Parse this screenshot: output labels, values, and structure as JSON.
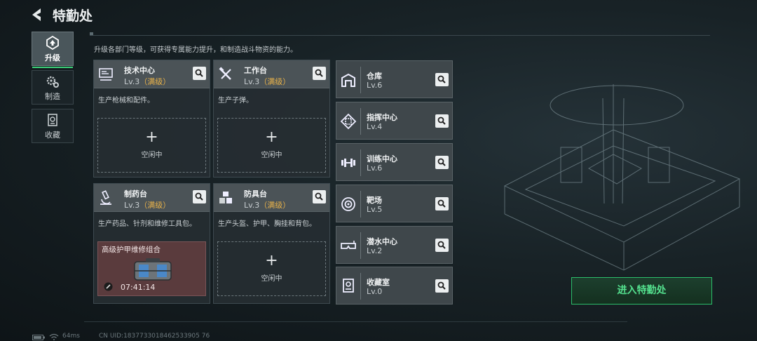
{
  "header": {
    "title": "特勤处"
  },
  "nav": {
    "items": [
      {
        "label": "升级",
        "icon": "upgrade-icon",
        "active": true
      },
      {
        "label": "制造",
        "icon": "gears-icon",
        "active": false
      },
      {
        "label": "收藏",
        "icon": "collection-icon",
        "active": false
      }
    ]
  },
  "description": "升级各部门等级，可获得专属能力提升，和制造战斗物资的能力。",
  "departments": [
    {
      "name": "技术中心",
      "level": "Lv.3",
      "max": "（满级）",
      "desc": "生产枪械和配件。",
      "slot": {
        "state": "idle",
        "plus": "+",
        "text": "空闲中"
      }
    },
    {
      "name": "工作台",
      "level": "Lv.3",
      "max": "（满级）",
      "desc": "生产子弹。",
      "slot": {
        "state": "idle",
        "plus": "+",
        "text": "空闲中"
      }
    },
    {
      "name": "制药台",
      "level": "Lv.3",
      "max": "（满级）",
      "desc": "生产药品、针剂和维修工具包。",
      "slot": {
        "state": "crafting",
        "item": "高级护甲维修组合",
        "time": "07:41:14"
      }
    },
    {
      "name": "防具台",
      "level": "Lv.3",
      "max": "（满级）",
      "desc": "生产头盔、护甲、胸挂和背包。",
      "slot": {
        "state": "idle",
        "plus": "+",
        "text": "空闲中"
      }
    }
  ],
  "facilities": [
    {
      "name": "仓库",
      "level": "Lv.6",
      "icon": "warehouse-icon"
    },
    {
      "name": "指挥中心",
      "level": "Lv.4",
      "icon": "command-center-icon"
    },
    {
      "name": "训练中心",
      "level": "Lv.6",
      "icon": "dumbbell-icon"
    },
    {
      "name": "靶场",
      "level": "Lv.5",
      "icon": "target-icon"
    },
    {
      "name": "潜水中心",
      "level": "Lv.2",
      "icon": "diving-mask-icon"
    },
    {
      "name": "收藏室",
      "level": "Lv.0",
      "icon": "trophy-icon"
    }
  ],
  "enter_button": "进入特勤处",
  "status": {
    "ping": "64ms",
    "uid": "CN UID:1837733018462533905 76"
  },
  "colors": {
    "accent_green": "#3cd27a",
    "max_level_gold": "#e8b24a",
    "crafting_bg": "#5a3b3d"
  }
}
